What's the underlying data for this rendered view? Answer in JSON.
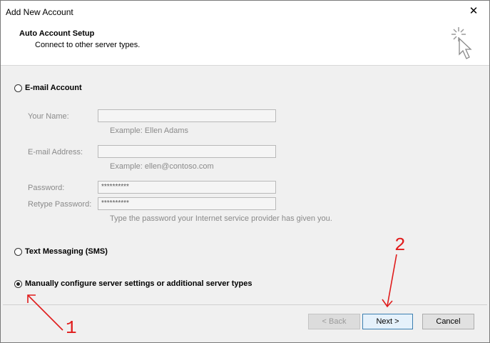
{
  "window": {
    "title": "Add New Account",
    "close_glyph": "✕"
  },
  "header": {
    "title": "Auto Account Setup",
    "subtitle": "Connect to other server types.",
    "icon": "wand-cursor-icon"
  },
  "email_account": {
    "radio_label": "E-mail Account",
    "name_label": "Your Name:",
    "name_value": "",
    "name_hint": "Example: Ellen Adams",
    "email_label": "E-mail Address:",
    "email_value": "",
    "email_hint": "Example: ellen@contoso.com",
    "password_label": "Password:",
    "password_value": "**********",
    "retype_label": "Retype Password:",
    "retype_value": "**********",
    "password_hint": "Type the password your Internet service provider has given you."
  },
  "options": {
    "sms_label": "Text Messaging (SMS)",
    "manual_label": "Manually configure server settings or additional server types",
    "selected": "manual"
  },
  "buttons": {
    "back": "< Back",
    "next": "Next >",
    "cancel": "Cancel"
  },
  "annotations": {
    "arrow1_number": "1",
    "arrow2_number": "2",
    "color": "#e01c1c"
  }
}
